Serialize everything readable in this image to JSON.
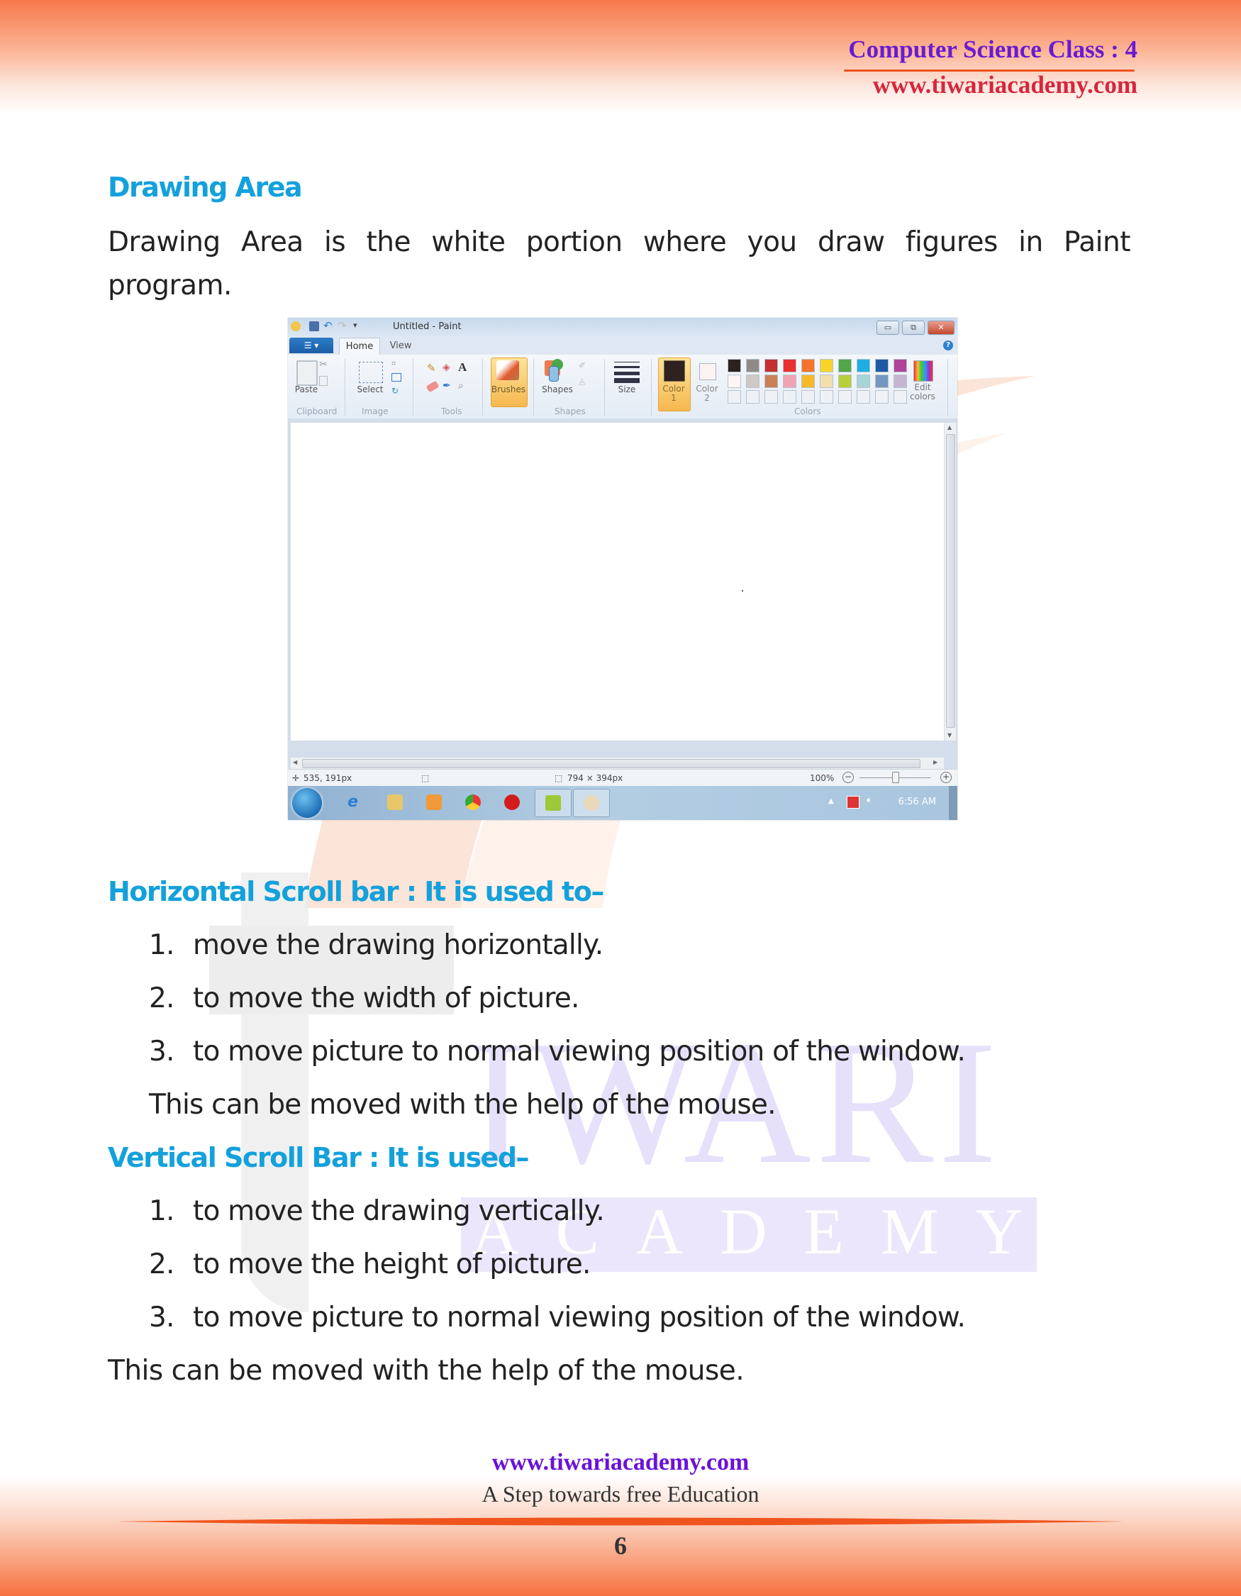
{
  "header": {
    "title": "Computer Science Class : 4",
    "url": "www.tiwariacademy.com"
  },
  "watermark": {
    "word1": "IWARI",
    "word2": "ACADEMY"
  },
  "section_drawing_area": {
    "heading": "Drawing Area",
    "paragraph_line1": "Drawing Area is the white portion where you draw figures in Paint",
    "paragraph_line2": "program."
  },
  "paint_window": {
    "title": "Untitled - Paint",
    "file_menu_label": "☰ ▾",
    "tabs": [
      {
        "label": "Home",
        "active": true
      },
      {
        "label": "View",
        "active": false
      }
    ],
    "window_controls": {
      "minimize": "▭",
      "restore": "⧉",
      "close": "✕"
    },
    "help_label": "?",
    "ribbon": {
      "groups": [
        {
          "name": "Clipboard",
          "buttons": [
            "Paste"
          ]
        },
        {
          "name": "Image",
          "buttons": [
            "Select"
          ]
        },
        {
          "name": "Tools",
          "buttons": []
        },
        {
          "name": "",
          "buttons": [
            "Brushes"
          ]
        },
        {
          "name": "Shapes",
          "buttons": [
            "Shapes"
          ]
        },
        {
          "name": "",
          "buttons": [
            "Size"
          ]
        },
        {
          "name": "Colors",
          "buttons": [
            "Color 1",
            "Color 2",
            "Edit colors"
          ]
        }
      ],
      "paste_label": "Paste",
      "select_label": "Select",
      "brushes_label": "Brushes",
      "shapes_label": "Shapes",
      "size_label": "Size",
      "color1_label_line1": "Color",
      "color1_label_line2": "1",
      "color2_label_line1": "Color",
      "color2_label_line2": "2",
      "edit_colors_line1": "Edit",
      "edit_colors_line2": "colors",
      "group_clipboard": "Clipboard",
      "group_image": "Image",
      "group_tools": "Tools",
      "group_shapes": "Shapes",
      "group_colors": "Colors",
      "color1_value": "#2e2220",
      "color2_value": "#fbf3f3",
      "palette_row1": [
        "#2b2220",
        "#8f8a88",
        "#c42f2f",
        "#ea2f2f",
        "#f3742a",
        "#f8d42a",
        "#52a647",
        "#1eaee2",
        "#1e5aa3",
        "#b0449a"
      ],
      "palette_row2": [
        "#fdf6f4",
        "#cfc9c6",
        "#c98055",
        "#efa3b5",
        "#f7b92a",
        "#f3dfac",
        "#b9cf3a",
        "#a7d4d4",
        "#7498bf",
        "#c6b4d2"
      ],
      "palette_row3_empty_count": 10
    },
    "status": {
      "cursor_position": "535, 191px",
      "canvas_size": "794 × 394px",
      "zoom_level": "100%",
      "zoom_slider_fraction": 0.5
    },
    "taskbar": {
      "pinned": [
        "start-orb",
        "internet-explorer",
        "file-explorer",
        "media-player",
        "chrome",
        "opera",
        "app-green",
        "paint"
      ],
      "clock": "6:56 AM"
    }
  },
  "section_horizontal": {
    "heading": "Horizontal Scroll bar : It is used to–",
    "items": [
      {
        "num": "1.",
        "text": "move the drawing horizontally."
      },
      {
        "num": "2.",
        "text": "to move the width of picture."
      },
      {
        "num": "3.",
        "text": "to move picture to normal  viewing position of the window."
      }
    ],
    "note": "This can be moved with the help of the mouse."
  },
  "section_vertical": {
    "heading": "Vertical Scroll Bar : It is used–",
    "items": [
      {
        "num": "1.",
        "text": "to move the drawing vertically."
      },
      {
        "num": "2.",
        "text": "to move the height of picture."
      },
      {
        "num": "3.",
        "text": "to move picture to normal viewing position of the window."
      }
    ],
    "note": "This can be moved with the help of the mouse."
  },
  "footer": {
    "url": "www.tiwariacademy.com",
    "tagline": "A Step towards free Education",
    "page_number": "6"
  },
  "colors": {
    "heading_blue": "#13a1db",
    "header_title_purple": "#6a1bd1",
    "header_url_red": "#d7263d",
    "footer_url_purple": "#6a12d8",
    "accent_orange": "#f0541e"
  }
}
